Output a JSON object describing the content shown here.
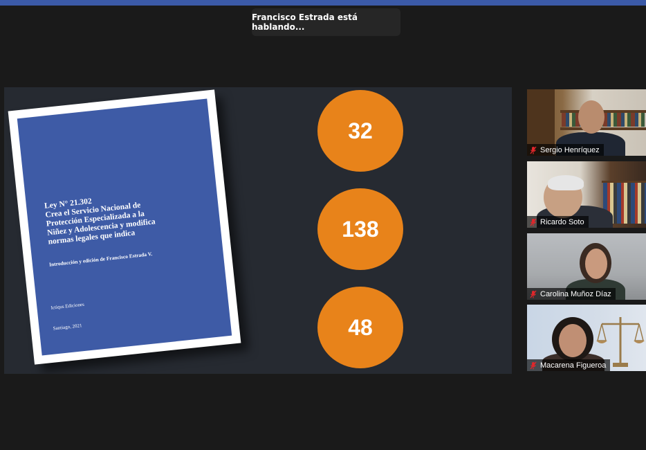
{
  "speaker_banner": "Francisco Estrada está hablando...",
  "document": {
    "title_lines": [
      "Ley N° 21.302",
      "Crea el Servicio Nacional de",
      "Protección Especializada a la",
      "Niñez y Adolescencia y modifica",
      "normas legales que indica"
    ],
    "edition": "Introducción y edición de Francisco Estrada V.",
    "publisher": "Ictiqus Ediciones",
    "place_year": "Santiago, 2021"
  },
  "stats": [
    "32",
    "138",
    "48"
  ],
  "participants": [
    {
      "name": "Sergio Henríquez",
      "muted": true
    },
    {
      "name": "Ricardo Soto",
      "muted": true
    },
    {
      "name": "Carolina Muñoz Díaz",
      "muted": true
    },
    {
      "name": "Macarena Figueroa",
      "muted": true
    }
  ],
  "colors": {
    "accent": "#e8831a",
    "doc_blue": "#3e5ba6",
    "topbar": "#3b5aa8",
    "muted_icon": "#e0262b"
  }
}
